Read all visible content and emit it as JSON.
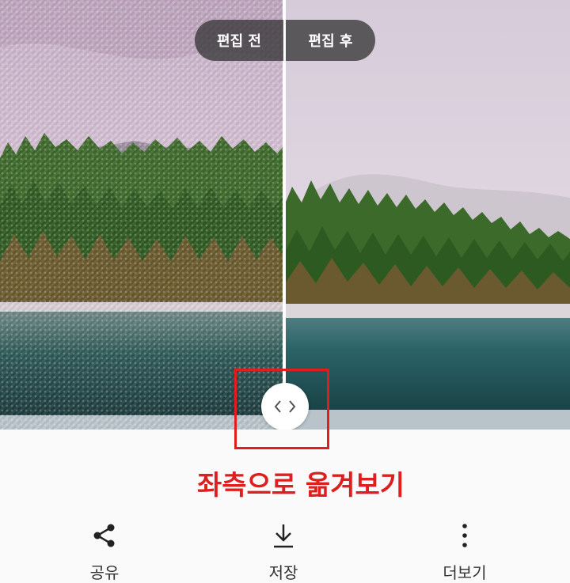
{
  "compare": {
    "before_label": "편집 전",
    "after_label": "편집 후"
  },
  "annotation": {
    "text": "좌측으로 옮겨보기",
    "color": "#dd1f1f"
  },
  "actions": [
    {
      "label": "공유",
      "icon": "share-icon"
    },
    {
      "label": "저장",
      "icon": "download-icon"
    },
    {
      "label": "더보기",
      "icon": "more-vertical-icon"
    }
  ],
  "colors": {
    "pill_bg": "#373737",
    "accent_red": "#e11d1d",
    "bottom_bar": "#fafafa"
  }
}
